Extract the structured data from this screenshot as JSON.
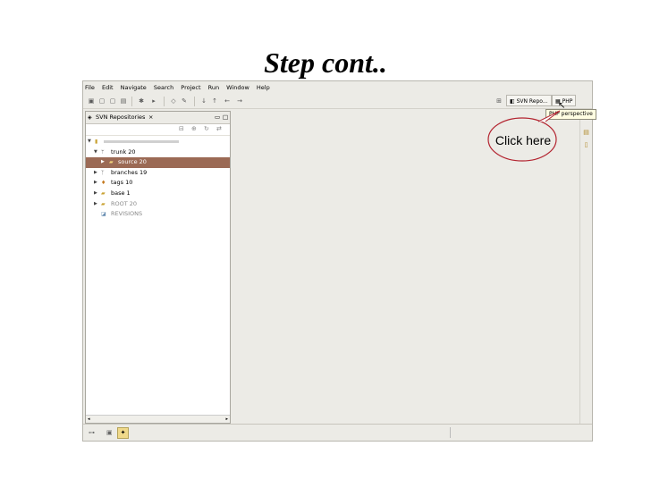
{
  "slide": {
    "title": "Step cont.."
  },
  "menu": [
    "File",
    "Edit",
    "Navigate",
    "Search",
    "Project",
    "Run",
    "Window",
    "Help"
  ],
  "toolbar": {
    "perspective_active": "SVN Repo...",
    "perspective_php": "PHP",
    "tooltip": "PHP perspective"
  },
  "view": {
    "title": "SVN Repositories",
    "tab_close": "×",
    "minimize": "▭",
    "maximize": "□"
  },
  "tree": {
    "root_label": "",
    "trunk": "trunk 20",
    "source": "source 20",
    "branches": "branches 19",
    "tags": "tags 10",
    "base": "base 1",
    "root": "ROOT 20",
    "revisions": "REVISIONS"
  },
  "annotation": {
    "text": "Click here",
    "color": "#b32430"
  },
  "colors": {
    "selection": "#9b6a55",
    "window_bg": "#ecebe6"
  },
  "icons": {
    "expand": "▼",
    "collapse": "▶",
    "folder": "📁"
  }
}
